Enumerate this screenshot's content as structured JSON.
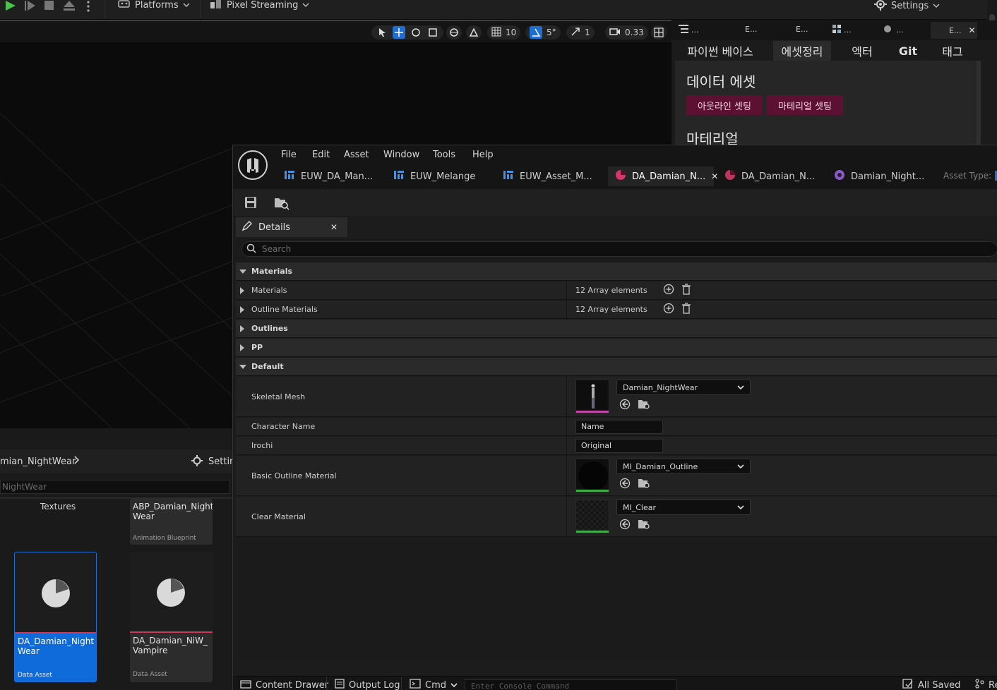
{
  "top_toolbar": {
    "platforms_label": "Platforms",
    "pixel_streaming_label": "Pixel Streaming",
    "settings_label": "Settings"
  },
  "viewport": {
    "grid_snap_value": "10",
    "rotation_snap_value": "5°",
    "scale_snap_value": "1",
    "camera_speed_value": "0.33"
  },
  "euw_panel": {
    "mini_tabs": [
      "...",
      "E...",
      "E...",
      "...",
      "...",
      "E..."
    ],
    "tabs": [
      "파이썬 베이스",
      "에셋정리",
      "엑터",
      "Git",
      "태그"
    ],
    "active_tab_index": 1,
    "section_title": "데이터 에셋",
    "buttons": [
      "아웃라인 셋팅",
      "마테리얼 셋팅"
    ],
    "section_title_2": "마테리얼",
    "button_color": "#5c1032"
  },
  "content_browser": {
    "path_label": "mian_NightWear",
    "settings_label": "Settin",
    "filter_text": "NightWear",
    "folder_label": "Textures",
    "assets": [
      {
        "name": "ABP_Damian_Night Wear",
        "type": "Animation Blueprint",
        "selected": false
      },
      {
        "name": "DA_Damian_Night Wear",
        "type": "Data Asset",
        "selected": true
      },
      {
        "name": "DA_Damian_NiW_ Vampire",
        "type": "Data Asset",
        "selected": false
      }
    ]
  },
  "asset_editor": {
    "menu": [
      "File",
      "Edit",
      "Asset",
      "Window",
      "Tools",
      "Help"
    ],
    "doc_tabs": [
      {
        "label": "EUW_DA_Man..."
      },
      {
        "label": "EUW_Melange"
      },
      {
        "label": "EUW_Asset_M..."
      },
      {
        "label": "DA_Damian_N..."
      },
      {
        "label": "DA_Damian_N..."
      },
      {
        "label": "Damian_Night..."
      }
    ],
    "asset_type_label": "Asset Type:",
    "details_tab_label": "Details",
    "search_placeholder": "Search",
    "categories": {
      "materials": "Materials",
      "outlines": "Outlines",
      "pp": "PP",
      "default": "Default"
    },
    "materials_rows": [
      {
        "name": "Materials",
        "value": "12 Array elements"
      },
      {
        "name": "Outline Materials",
        "value": "12 Array elements"
      }
    ],
    "default_rows": {
      "skeletal_mesh": {
        "name": "Skeletal Mesh",
        "value": "Damian_NightWear"
      },
      "character_name": {
        "name": "Character Name",
        "value": "Name"
      },
      "irochi": {
        "name": "Irochi",
        "value": "Original"
      },
      "basic_outline_material": {
        "name": "Basic Outline Material",
        "value": "MI_Damian_Outline"
      },
      "clear_material": {
        "name": "Clear Material",
        "value": "MI_Clear"
      }
    },
    "status_bar": {
      "content_drawer": "Content Drawer",
      "output_log": "Output Log",
      "cmd": "Cmd",
      "console_placeholder": "Enter Console Command",
      "all_saved": "All Saved",
      "revision": "Re"
    }
  }
}
